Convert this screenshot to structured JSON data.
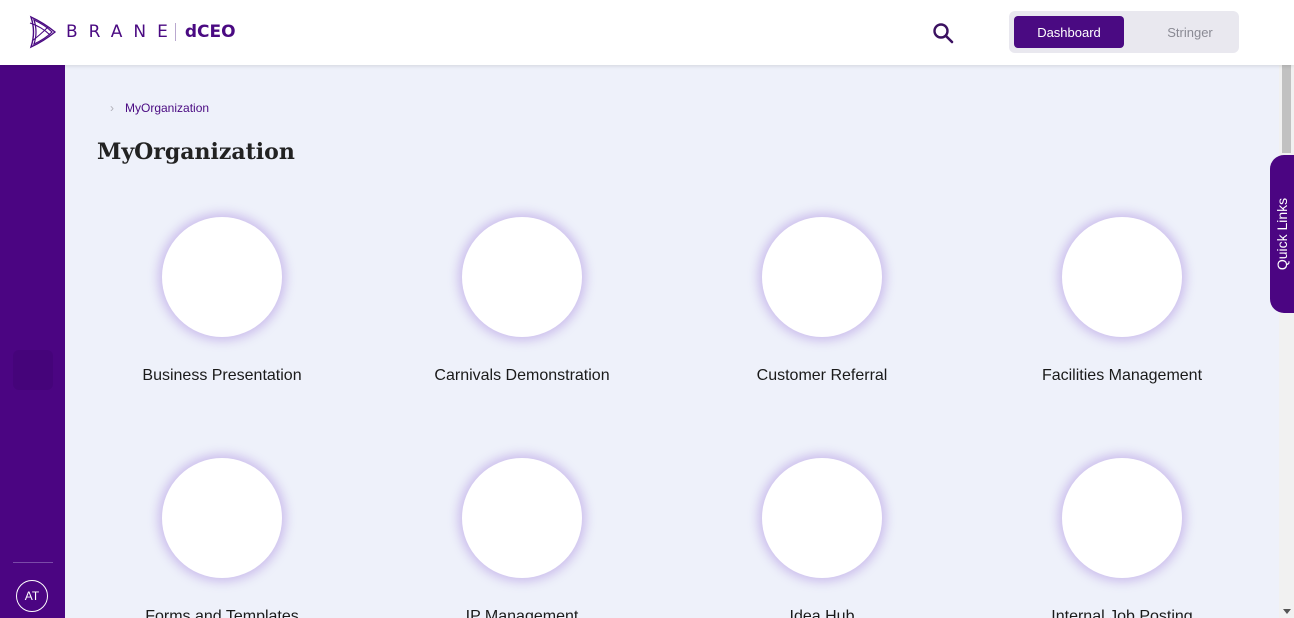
{
  "header": {
    "logo": {
      "brand": "BRANE",
      "product": "dCEO"
    },
    "toggle": {
      "active": "Dashboard",
      "inactive": "Stringer"
    }
  },
  "sidebar": {
    "avatar_initials": "AT"
  },
  "breadcrumb": {
    "current": "MyOrganization"
  },
  "page": {
    "title": "MyOrganization"
  },
  "tiles": [
    {
      "label": "Business Presentation"
    },
    {
      "label": "Carnivals Demonstration"
    },
    {
      "label": "Customer Referral"
    },
    {
      "label": "Facilities Management"
    },
    {
      "label": "Forms and Templates"
    },
    {
      "label": "IP Management"
    },
    {
      "label": "Idea Hub"
    },
    {
      "label": "Internal Job Posting"
    }
  ],
  "quick_links": {
    "label": "Quick Links"
  },
  "colors": {
    "brand": "#4b0582",
    "background": "#eef1fa",
    "accent_glow": "#a382de"
  }
}
